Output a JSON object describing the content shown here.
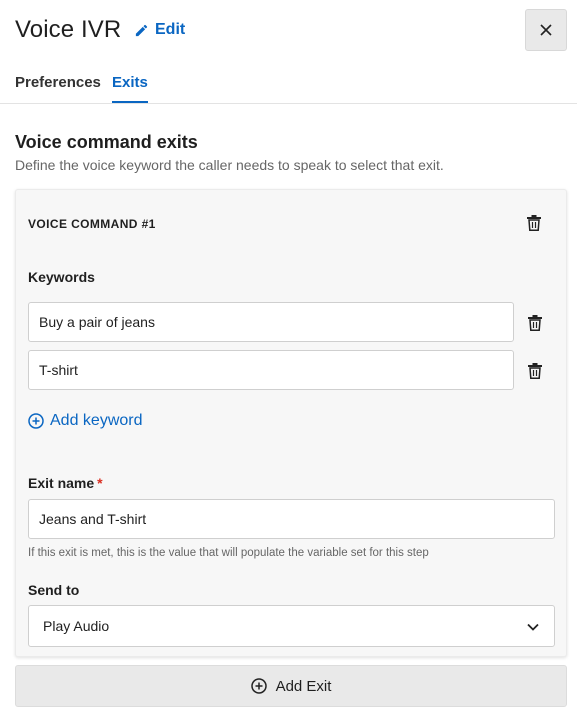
{
  "header": {
    "title": "Voice IVR",
    "edit_label": "Edit",
    "edit_icon": "pencil-icon",
    "close_icon": "close-icon"
  },
  "tabs": [
    {
      "label": "Preferences",
      "active": false
    },
    {
      "label": "Exits",
      "active": true
    }
  ],
  "section": {
    "title": "Voice command exits",
    "description": "Define the voice keyword the caller needs to speak to select that exit."
  },
  "voice_command": {
    "title": "VOICE COMMAND #1",
    "keywords_label": "Keywords",
    "keywords": [
      "Buy a pair of jeans",
      "T-shirt"
    ],
    "add_keyword_label": "Add keyword",
    "exit_name_label": "Exit name",
    "exit_name_required_mark": "*",
    "exit_name_value": "Jeans and T-shirt",
    "exit_name_hint": "If this exit is met, this is the value that will populate the variable set for this step",
    "send_to_label": "Send to",
    "send_to_value": "Play Audio"
  },
  "add_exit_label": "Add Exit",
  "colors": {
    "accent": "#0a66c2",
    "required": "#d92d20",
    "card_bg": "#f7f7f7"
  }
}
